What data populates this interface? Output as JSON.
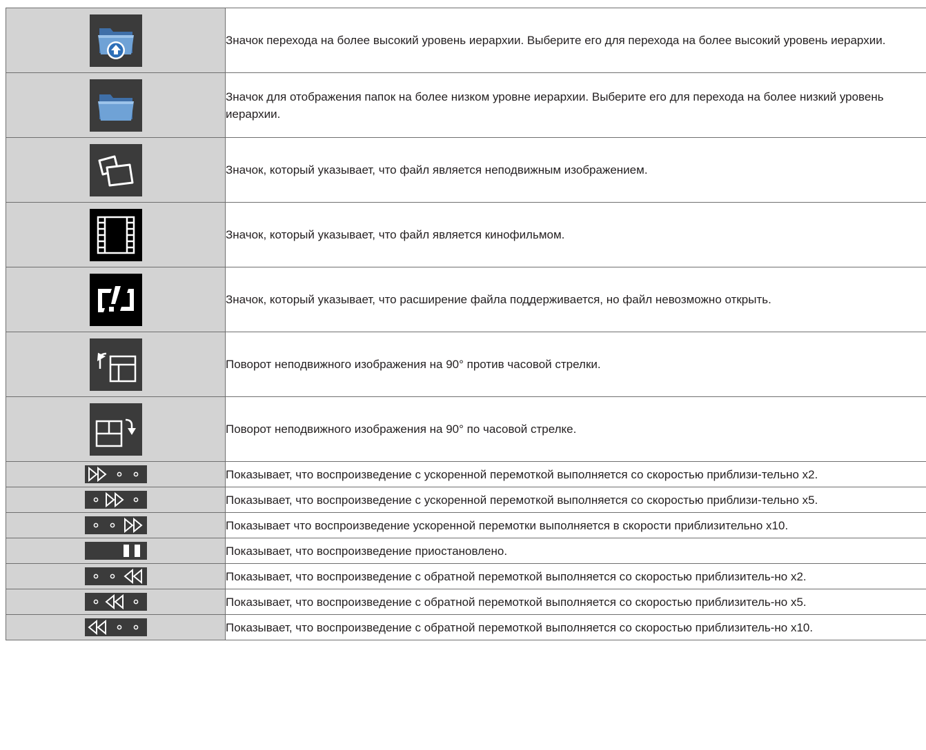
{
  "rows": [
    {
      "icon": "folder-up-icon",
      "text": "Значок перехода на более высокий уровень иерархии. Выберите его для перехода на более высокий уровень иерархии."
    },
    {
      "icon": "folder-icon",
      "text": "Значок для отображения папок на более низком уровне иерархии. Выберите его для перехода на более низкий уровень иерархии."
    },
    {
      "icon": "still-image-icon",
      "text": "Значок, который указывает, что файл является неподвижным изображением."
    },
    {
      "icon": "movie-film-icon",
      "text": "Значок, который указывает, что файл является кинофильмом."
    },
    {
      "icon": "unsupported-file-warning-icon",
      "text": "Значок, который указывает, что расширение файла поддерживается, но файл невозможно открыть."
    },
    {
      "icon": "rotate-left-icon",
      "text": "Поворот неподвижного изображения на 90° против часовой стрелки."
    },
    {
      "icon": "rotate-right-icon",
      "text": "Поворот неподвижного изображения на 90° по часовой стрелке."
    },
    {
      "icon": "fast-forward-x2-indicator",
      "text": "Показывает, что воспроизведение с ускоренной перемоткой выполняется со скоростью приблизи-тельно x2."
    },
    {
      "icon": "fast-forward-x5-indicator",
      "text": "Показывает, что воспроизведение с ускоренной перемоткой выполняется со скоростью приблизи-тельно x5."
    },
    {
      "icon": "fast-forward-x10-indicator",
      "text": "Показывает что воспроизведение ускоренной перемотки выполняется в скорости приблизительно x10."
    },
    {
      "icon": "pause-indicator",
      "text": "Показывает, что воспроизведение приостановлено."
    },
    {
      "icon": "rewind-x2-indicator",
      "text": "Показывает, что воспроизведение с обратной перемоткой выполняется со скоростью приблизитель-но x2."
    },
    {
      "icon": "rewind-x5-indicator",
      "text": "Показывает, что воспроизведение с обратной перемоткой выполняется со скоростью приблизитель-но x5."
    },
    {
      "icon": "rewind-x10-indicator",
      "text": "Показывает, что воспроизведение с обратной перемоткой выполняется со скоростью приблизитель-но x10."
    }
  ]
}
